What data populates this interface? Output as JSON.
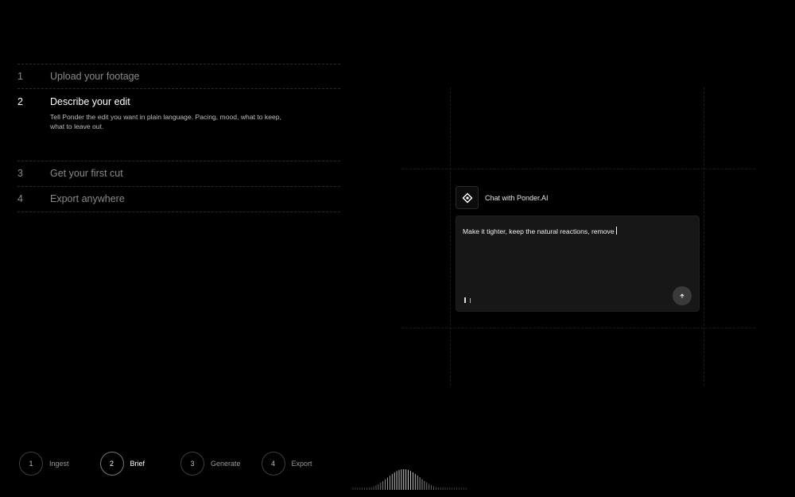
{
  "steps": [
    {
      "number": "1",
      "title": "Upload your footage"
    },
    {
      "number": "2",
      "title": "Describe your edit",
      "description": "Tell Ponder the edit you want in plain language. Pacing, mood, what to keep, what to leave out."
    },
    {
      "number": "3",
      "title": "Get your first cut"
    },
    {
      "number": "4",
      "title": "Export anywhere"
    }
  ],
  "chat": {
    "title": "Chat with Ponder.AI",
    "input_text": "Make it tighter, keep the natural reactions, remove",
    "logo_icon": "ponder-logo-icon",
    "send_icon": "arrow-up-icon"
  },
  "stepper": [
    {
      "number": "1",
      "label": "Ingest"
    },
    {
      "number": "2",
      "label": "Brief"
    },
    {
      "number": "3",
      "label": "Generate"
    },
    {
      "number": "4",
      "label": "Export"
    }
  ],
  "active_step": 2
}
